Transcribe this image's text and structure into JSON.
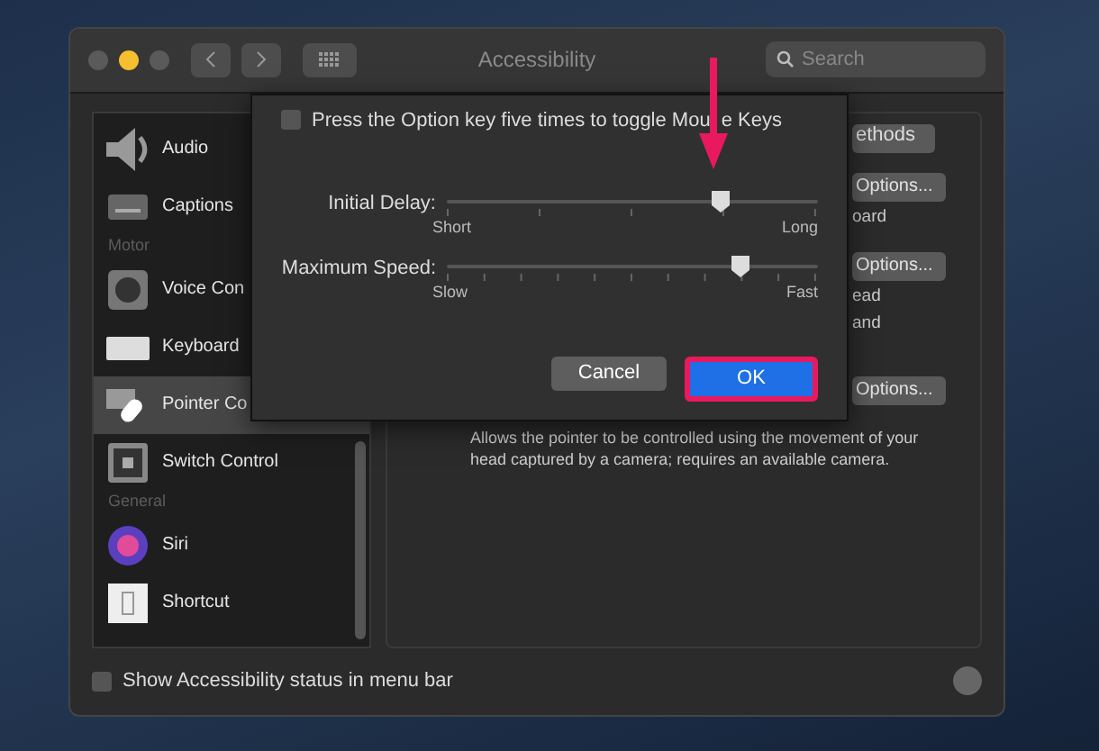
{
  "window": {
    "title": "Accessibility",
    "search": {
      "placeholder": "Search"
    }
  },
  "sidebar": {
    "items": [
      {
        "kind": "item",
        "label": "Audio",
        "selected": false
      },
      {
        "kind": "item",
        "label": "Captions",
        "selected": false
      },
      {
        "kind": "header",
        "label": "Motor"
      },
      {
        "kind": "item",
        "label": "Voice Con",
        "selected": false
      },
      {
        "kind": "item",
        "label": "Keyboard",
        "selected": false
      },
      {
        "kind": "item",
        "label": "Pointer Co",
        "selected": true
      },
      {
        "kind": "item",
        "label": "Switch Control",
        "selected": false
      },
      {
        "kind": "header",
        "label": "General"
      },
      {
        "kind": "item",
        "label": "Siri",
        "selected": false
      },
      {
        "kind": "item",
        "label": "Shortcut",
        "selected": false
      }
    ]
  },
  "panel": {
    "tab": "ethods",
    "options": [
      {
        "button": "Options...",
        "note": [
          "oard"
        ]
      },
      {
        "button": "Options...",
        "note": [
          "ead",
          "and"
        ]
      },
      {
        "button": "Options..."
      }
    ],
    "description": "Allows the pointer to be controlled using the movement of your head captured by a camera; requires an available camera."
  },
  "dialog": {
    "toggle": {
      "label": [
        "Press the Option key five times to toggle Mou",
        "e Keys"
      ],
      "checked": false
    },
    "sliders": [
      {
        "label": "Initial Delay:",
        "level": 0.74,
        "min_label": "Short",
        "max_label": "Long"
      },
      {
        "label": "Maximum Speed:",
        "level": 0.79,
        "min_label": "Slow",
        "max_label": "Fast"
      }
    ],
    "buttons": [
      {
        "label": "Cancel",
        "kind": "secondary"
      },
      {
        "label": "OK",
        "kind": "primary",
        "highlighted": true
      }
    ]
  },
  "footer": {
    "status_checkbox": {
      "label": "Show Accessibility status in menu bar",
      "checked": false
    }
  }
}
